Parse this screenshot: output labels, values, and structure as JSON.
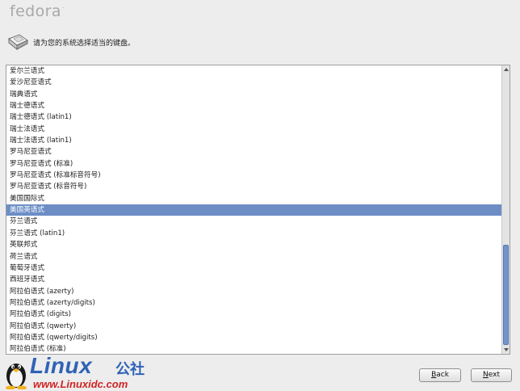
{
  "brand": {
    "name": "fedora",
    "mark": "."
  },
  "header": {
    "prompt": "请为您的系统选择适当的键盘。"
  },
  "keyboard_list": {
    "items": [
      "爱尔兰语式",
      "爱沙尼亚语式",
      "瑞典语式",
      "瑞士德语式",
      "瑞士德语式 (latin1)",
      "瑞士法语式",
      "瑞士法语式 (latin1)",
      "罗马尼亚语式",
      "罗马尼亚语式 (标准)",
      "罗马尼亚语式 (标准标音符号)",
      "罗马尼亚语式 (标音符号)",
      "美国国际式",
      "美国英语式",
      "芬兰语式",
      "芬兰语式 (latin1)",
      "英联邦式",
      "荷兰语式",
      "葡萄牙语式",
      "西班牙语式",
      "阿拉伯语式 (azerty)",
      "阿拉伯语式 (azerty/digits)",
      "阿拉伯语式 (digits)",
      "阿拉伯语式 (qwerty)",
      "阿拉伯语式 (qwerty/digits)",
      "阿拉伯语式 (标准)"
    ],
    "selected": "美国英语式"
  },
  "watermark": {
    "word": "Linux",
    "cn": "公社",
    "url": "www.Linuxidc.com"
  },
  "buttons": {
    "back": "Back",
    "next": "Next"
  }
}
